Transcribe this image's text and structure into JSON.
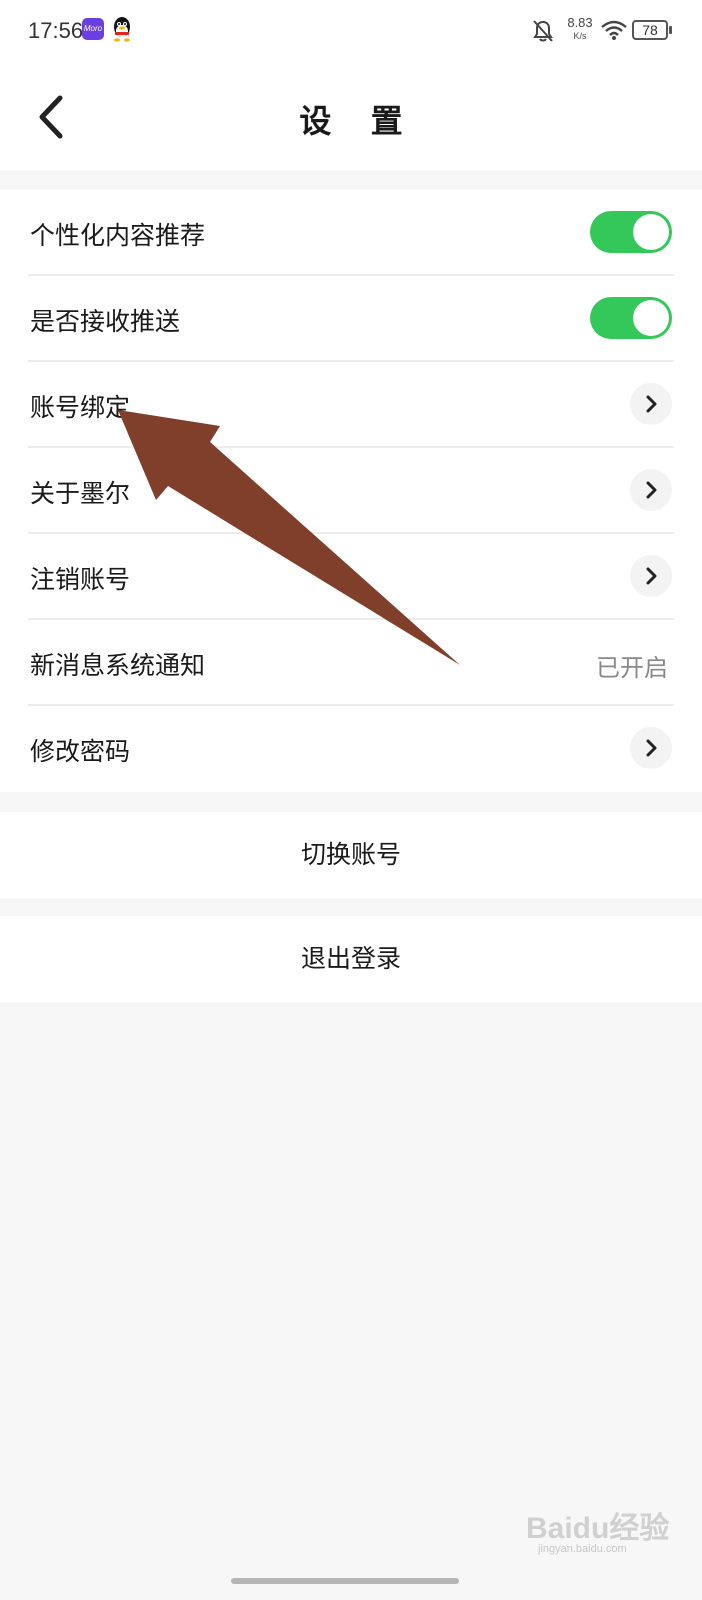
{
  "status_bar": {
    "time": "17:56",
    "app_icon_text": "Moro",
    "network_speed_value": "8.83",
    "network_speed_unit": "K/s",
    "battery_level": "78",
    "icons": [
      "moro-app-icon",
      "qq-icon",
      "bell-off-icon",
      "wifi-icon",
      "battery-icon"
    ]
  },
  "header": {
    "title": "设 置",
    "back_icon": "chevron-left-icon"
  },
  "settings": {
    "items": [
      {
        "label": "个性化内容推荐",
        "control": "toggle",
        "enabled": true
      },
      {
        "label": "是否接收推送",
        "control": "toggle",
        "enabled": true
      },
      {
        "label": "账号绑定",
        "control": "chevron"
      },
      {
        "label": "关于墨尔",
        "control": "chevron"
      },
      {
        "label": "注销账号",
        "control": "chevron"
      },
      {
        "label": "新消息系统通知",
        "control": "value",
        "value": "已开启"
      },
      {
        "label": "修改密码",
        "control": "chevron"
      }
    ]
  },
  "actions": {
    "switch_account": "切换账号",
    "logout": "退出登录"
  },
  "watermark": {
    "text": "Baidu经验",
    "url_text": "jingyan.baidu.com"
  },
  "colors": {
    "toggle_on": "#34c759",
    "annotation_arrow": "#7f3f2a",
    "background": "#f7f7f7"
  }
}
